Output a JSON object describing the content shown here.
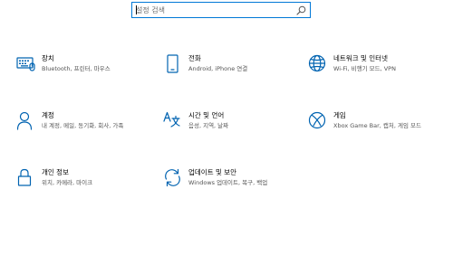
{
  "search": {
    "placeholder": "설정 검색",
    "icon": "search-icon"
  },
  "accent_color": "#0078d7",
  "icon_color": "#0063b1",
  "tiles": [
    {
      "title": "장치",
      "desc": "Bluetooth, 프린터, 마우스",
      "icon": "keyboard-icon"
    },
    {
      "title": "전화",
      "desc": "Android, iPhone 연결",
      "icon": "phone-icon"
    },
    {
      "title": "네트워크 및 인터넷",
      "desc": "Wi-Fi, 비행기 모드, VPN",
      "icon": "globe-icon"
    },
    {
      "title": "계정",
      "desc": "내 계정, 메일, 동기화, 회사, 가족",
      "icon": "person-icon"
    },
    {
      "title": "시간 및 언어",
      "desc": "음성, 지역, 날짜",
      "icon": "time-language-icon"
    },
    {
      "title": "게임",
      "desc": "Xbox Game Bar, 캡처, 게임 모드",
      "icon": "xbox-icon"
    },
    {
      "title": "개인 정보",
      "desc": "위치, 카메라, 마이크",
      "icon": "lock-icon"
    },
    {
      "title": "업데이트 및 보안",
      "desc": "Windows 업데이트, 복구, 백업",
      "icon": "sync-icon"
    }
  ]
}
